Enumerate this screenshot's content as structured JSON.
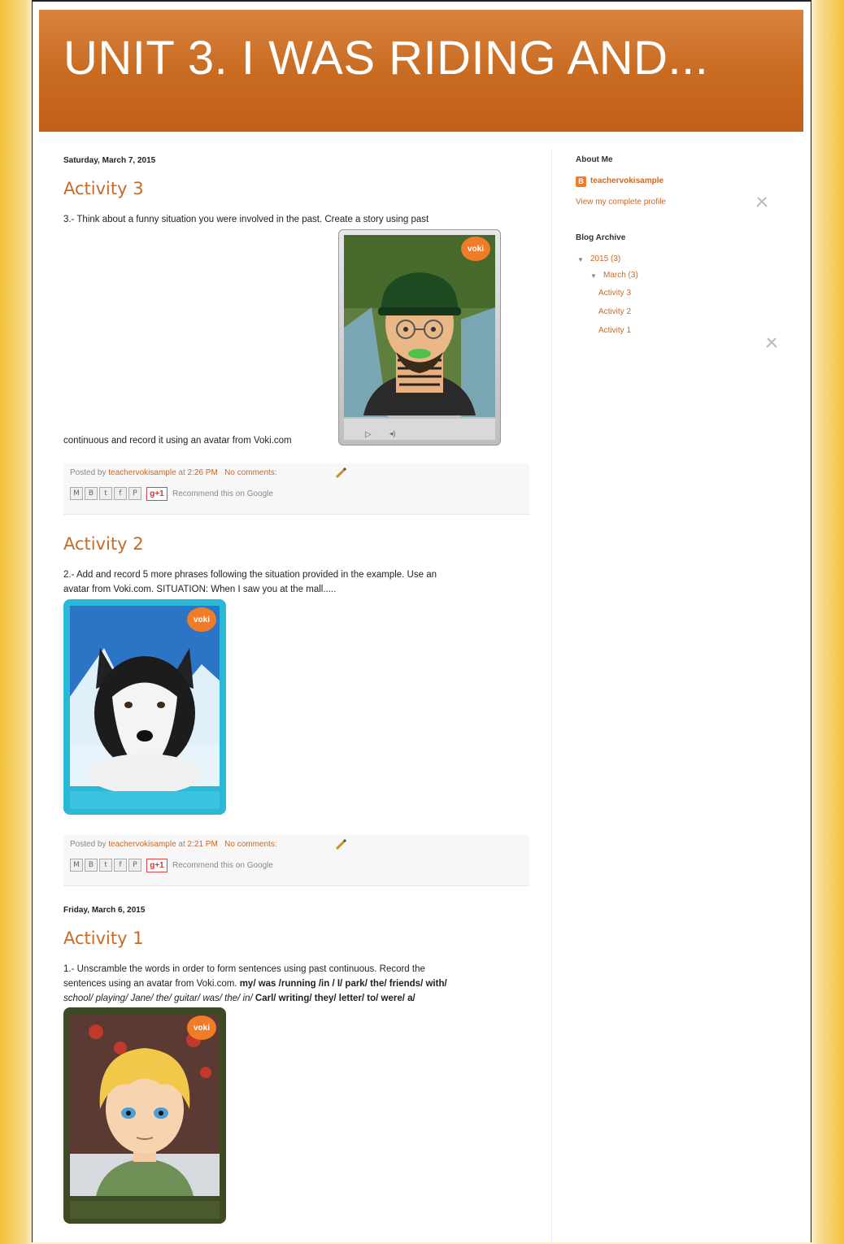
{
  "header": {
    "title": "UNIT 3. I WAS RIDING AND..."
  },
  "posts": [
    {
      "date": "Saturday, March 7, 2015",
      "title": "Activity 3",
      "body_line1": "3.- Think about a funny situation you were involved in the past. Create a story using past",
      "body_line2": "continuous and record it using an avatar from Voki.com",
      "footer": {
        "posted_by": "Posted by",
        "author": "teachervokisample",
        "at": "at",
        "time": "2:26 PM",
        "comments": "No comments:",
        "recommend": "Recommend this on Google"
      }
    },
    {
      "title": "Activity 2",
      "body_line1": "2.- Add and record 5 more phrases following the situation provided in the example. Use an",
      "body_line2": "avatar from Voki.com. SITUATION: When I saw you at the mall.....",
      "footer": {
        "posted_by": "Posted by",
        "author": "teachervokisample",
        "at": "at",
        "time": "2:21 PM",
        "comments": "No comments:",
        "recommend": "Recommend this on Google"
      }
    },
    {
      "date": "Friday, March 6, 2015",
      "title": "Activity 1",
      "body_line1": "1.- Unscramble the words in order to form sentences using past continuous. Record the",
      "body_line2_plain": "sentences using an avatar from Voki.com.",
      "body_line2_bold": "my/ was /running /in / I/ park/ the/ friends/ with/",
      "body_line3_italic": "school/ playing/ Jane/ the/ guitar/ was/ the/ in/",
      "body_line3_bold": "Carl/ writing/ they/ letter/ to/ were/ a/"
    }
  ],
  "share_buttons": [
    "M",
    "B",
    "t",
    "f",
    "P"
  ],
  "gplus_label": "g+1",
  "voki_badge": "voki",
  "sidebar": {
    "about_heading": "About Me",
    "profile_name": "teachervokisample",
    "view_profile": "View my complete profile",
    "archive_heading": "Blog Archive",
    "year": "2015 (3)",
    "month": "March (3)",
    "posts": [
      "Activity 3",
      "Activity 2",
      "Activity 1"
    ]
  }
}
